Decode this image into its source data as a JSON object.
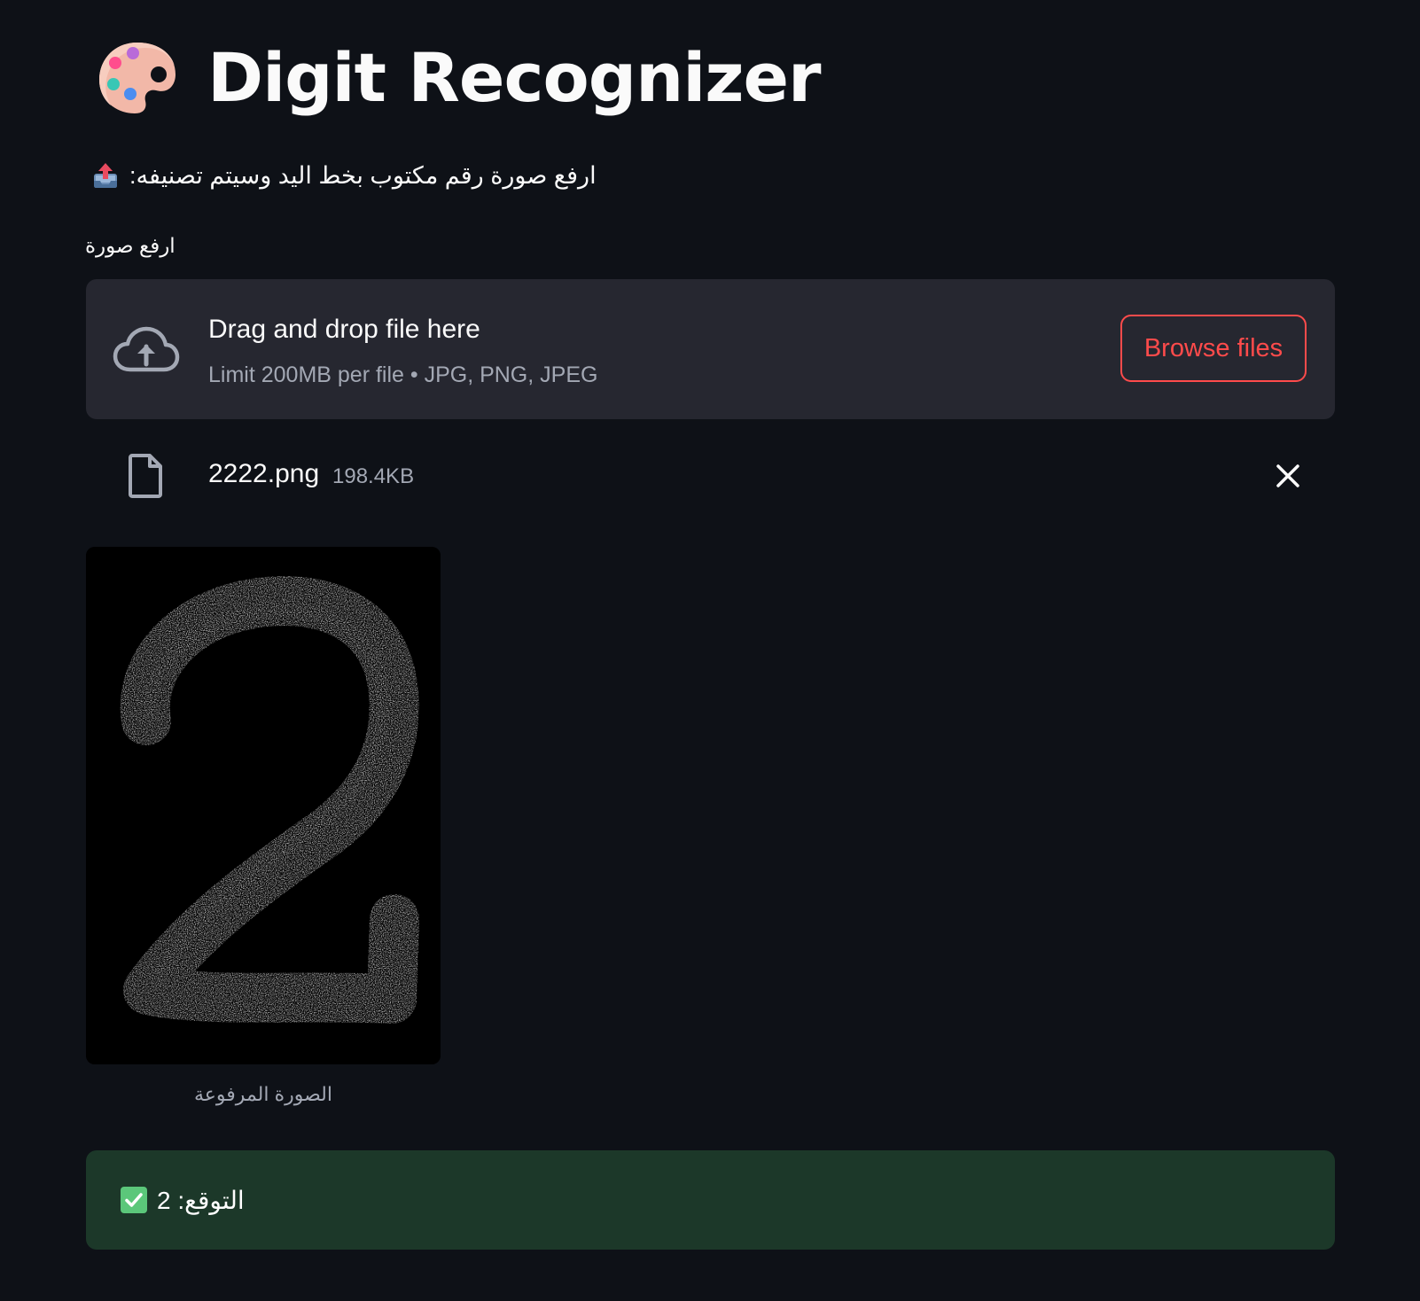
{
  "header": {
    "title": "Digit Recognizer",
    "icon": "palette-icon"
  },
  "instruction": {
    "icon": "inbox-tray-icon",
    "text": "ارفع صورة رقم مكتوب بخط اليد وسيتم تصنيفه:"
  },
  "uploader": {
    "label": "ارفع صورة",
    "dropzone_title": "Drag and drop file here",
    "dropzone_limit": "Limit 200MB per file • JPG, PNG, JPEG",
    "browse_label": "Browse files",
    "icon": "cloud-upload-icon"
  },
  "uploaded_file": {
    "name": "2222.png",
    "size": "198.4KB",
    "icon": "file-icon",
    "delete_icon": "close-icon"
  },
  "image": {
    "caption": "الصورة المرفوعة"
  },
  "result": {
    "icon": "check-mark-icon",
    "text": "التوقع: 2"
  },
  "colors": {
    "background": "#0e1117",
    "dropzone": "#262730",
    "accent": "#ff4b4b",
    "success_bg": "#1c3829",
    "muted_text": "#a3a8b4"
  }
}
